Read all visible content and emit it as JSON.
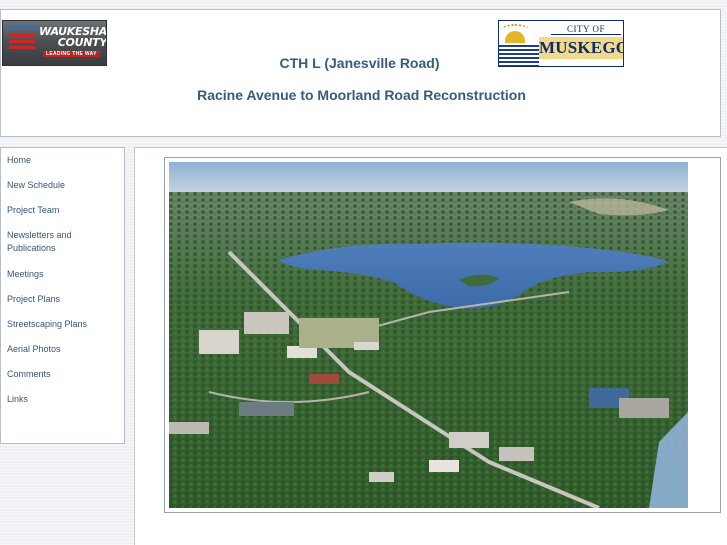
{
  "header": {
    "title_line1": "CTH L (Janesville Road)",
    "title_line2": "Racine Avenue to Moorland Road Reconstruction",
    "logo_left": {
      "name": "WAUKESHA COUNTY",
      "tagline": "LEADING THE WAY"
    },
    "logo_right": {
      "prefix": "CITY OF",
      "name": "MUSKEGO"
    }
  },
  "nav": {
    "items": [
      "Home",
      "New Schedule",
      "Project Team",
      "Newsletters and Publications",
      "Meetings",
      "Project Plans",
      "Streetscaping Plans",
      "Aerial Photos",
      "Comments",
      "Links"
    ]
  },
  "main": {
    "image": "aerial-photo-of-town-and-lake"
  },
  "colors": {
    "link": "#35567a",
    "title": "#355c80",
    "background": "#eef0f4"
  }
}
